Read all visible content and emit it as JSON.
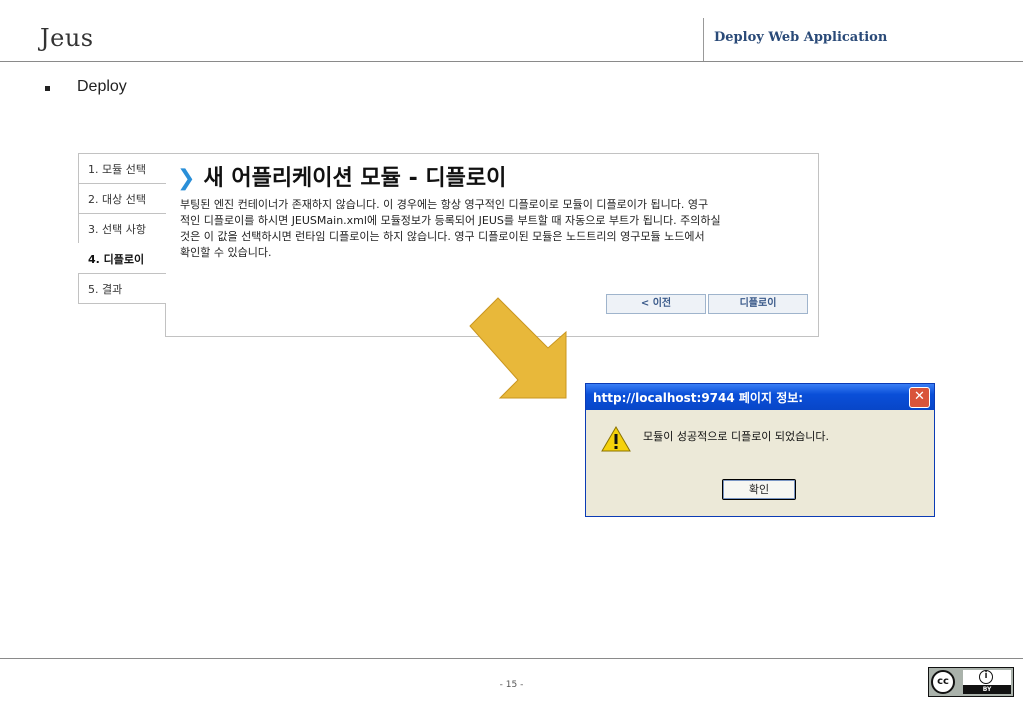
{
  "header": {
    "title": "Jeus",
    "section": "Deploy Web Application"
  },
  "bullet": {
    "text": "Deploy"
  },
  "wizard": {
    "steps": [
      "1. 모듈 선택",
      "2. 대상 선택",
      "3. 선택 사항",
      "4. 디플로이",
      "5. 결과"
    ],
    "active_step": 3,
    "title": "새 어플리케이션 모듈 - 디플로이",
    "description_lines": [
      "부팅된 엔진 컨테이너가 존재하지 않습니다. 이 경우에는 항상 영구적인 디플로이로 모듈이 디플로이가 됩니다. 영구",
      "적인 디플로이를 하시면 JEUSMain.xml에 모듈정보가 등록되어 JEUS를 부트할 때 자동으로 부트가 됩니다. 주의하실",
      "것은 이 값을 선택하시면 런타임 디플로이는 하지 않습니다. 영구 디플로이된 모듈은 노드트리의 영구모듈 노드에서",
      "확인할 수 있습니다."
    ],
    "prev_button": "< 이전",
    "deploy_button": "디플로이"
  },
  "dialog": {
    "title": "http://localhost:9744 페이지 정보:",
    "message": "모듈이 성공적으로 디플로이 되었습니다.",
    "ok_button": "확인",
    "close_icon": "close-icon",
    "warning_icon": "warning-icon"
  },
  "footer": {
    "page_number": "- 15 -",
    "license_badge": "BY"
  },
  "colors": {
    "accent_blue": "#2a8fd8",
    "arrow_gold": "#e8b83a",
    "dialog_titlebar": "#0a4fd8"
  }
}
